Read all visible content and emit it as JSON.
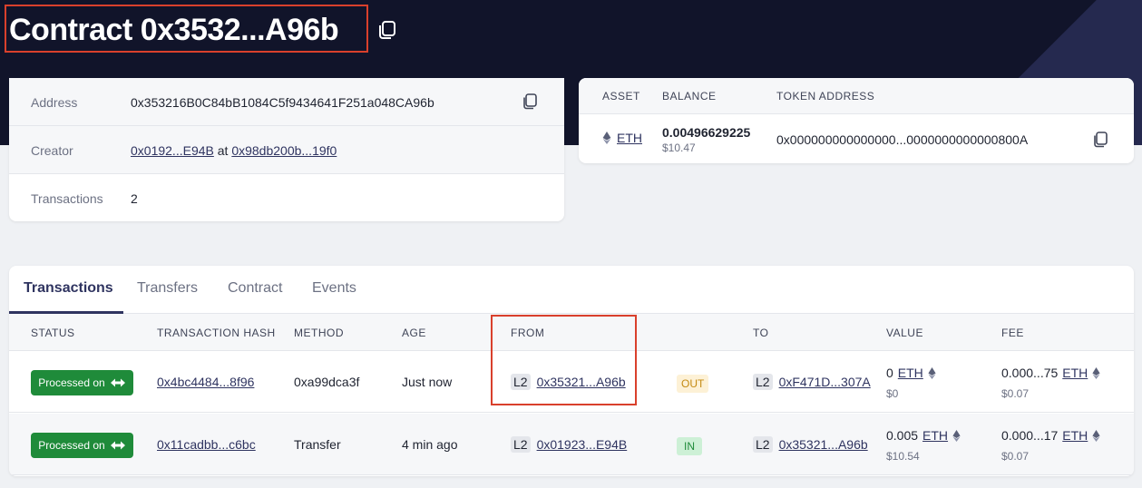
{
  "header": {
    "title": "Contract 0x3532...A96b"
  },
  "info": {
    "address_label": "Address",
    "address_value": "0x353216B0C84bB1084C5f9434641F251a048CA96b",
    "creator_label": "Creator",
    "creator_address": "0x0192...E94B",
    "creator_at": "at",
    "creator_tx": "0x98db200b...19f0",
    "transactions_label": "Transactions",
    "transactions_value": "2"
  },
  "balances": {
    "headers": {
      "asset": "ASSET",
      "balance": "BALANCE",
      "token_address": "TOKEN ADDRESS"
    },
    "rows": [
      {
        "asset": "ETH",
        "amount": "0.00496629225",
        "usd": "$10.47",
        "token_address": "0x000000000000000...0000000000000800A"
      }
    ]
  },
  "tabs": [
    {
      "label": "Transactions",
      "active": true
    },
    {
      "label": "Transfers",
      "active": false
    },
    {
      "label": "Contract",
      "active": false
    },
    {
      "label": "Events",
      "active": false
    }
  ],
  "table": {
    "headers": {
      "status": "STATUS",
      "hash": "TRANSACTION HASH",
      "method": "METHOD",
      "age": "AGE",
      "from": "FROM",
      "to": "TO",
      "value": "VALUE",
      "fee": "FEE"
    },
    "rows": [
      {
        "status": "Processed on",
        "hash": "0x4bc4484...8f96",
        "method": "0xa99dca3f",
        "age": "Just now",
        "from_layer": "L2",
        "from": "0x35321...A96b",
        "direction": "OUT",
        "to_layer": "L2",
        "to": "0xF471D...307A",
        "value": "0",
        "value_token": "ETH",
        "value_usd": "$0",
        "fee": "0.000...75",
        "fee_token": "ETH",
        "fee_usd": "$0.07"
      },
      {
        "status": "Processed on",
        "hash": "0x11cadbb...c6bc",
        "method": "Transfer",
        "age": "4 min ago",
        "from_layer": "L2",
        "from": "0x01923...E94B",
        "direction": "IN",
        "to_layer": "L2",
        "to": "0x35321...A96b",
        "value": "0.005",
        "value_token": "ETH",
        "value_usd": "$10.54",
        "fee": "0.000...17",
        "fee_token": "ETH",
        "fee_usd": "$0.07"
      }
    ]
  },
  "colors": {
    "hero_bg": "#11142a",
    "accent": "#2f3460",
    "success": "#1f8b3a",
    "highlight_box": "#d9402c"
  },
  "icons": [
    "copy-icon",
    "eth-icon",
    "bridge-arrows-icon"
  ]
}
